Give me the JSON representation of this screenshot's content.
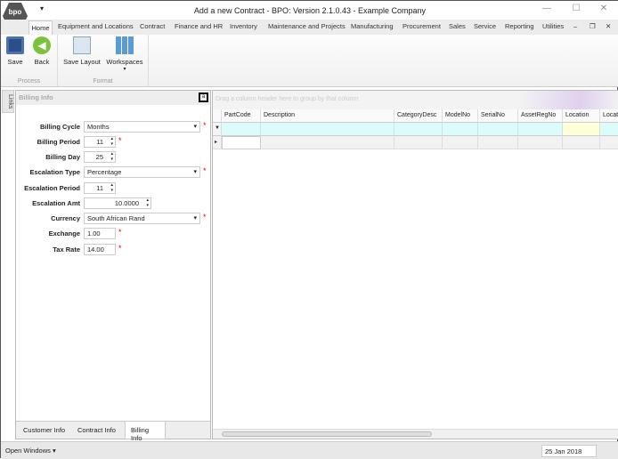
{
  "window": {
    "title": "Add a new Contract - BPO: Version 2.1.0.43 - Example Company",
    "logo": "bpo",
    "qat": "▾",
    "minimize": "—",
    "maximize": "☐",
    "close": "✕",
    "mdi_min": "–",
    "mdi_restore": "❐",
    "mdi_close": "✕"
  },
  "tabs": [
    "Home",
    "Equipment and Locations",
    "Contract",
    "Finance and HR",
    "Inventory",
    "Maintenance and Projects",
    "Manufacturing",
    "Procurement",
    "Sales",
    "Service",
    "Reporting",
    "Utilities"
  ],
  "ribbon": {
    "save": "Save",
    "back": "Back",
    "save_layout": "Save Layout",
    "workspaces": "Workspaces",
    "group_process": "Process",
    "group_format": "Format"
  },
  "links_tab": "Links",
  "panel": {
    "title": "Billing Info",
    "pin": "a",
    "fields": [
      {
        "label": "Billing Cycle",
        "value": "Months",
        "type": "dropdown",
        "required": true
      },
      {
        "label": "Billing Period",
        "value": "11",
        "type": "spin",
        "required": true
      },
      {
        "label": "Billing Day",
        "value": "25",
        "type": "spin",
        "required": false
      },
      {
        "label": "Escalation Type",
        "value": "Percentage",
        "type": "dropdown",
        "required": true
      },
      {
        "label": "Escalation Period",
        "value": "11",
        "type": "spin",
        "required": false
      },
      {
        "label": "Escalation Amt",
        "value": "10.0000",
        "type": "spinwide",
        "required": false
      },
      {
        "label": "Currency",
        "value": "South African Rand",
        "type": "dropdown",
        "required": true
      },
      {
        "label": "Exchange",
        "value": "1.00",
        "type": "text",
        "required": true
      },
      {
        "label": "Tax Rate",
        "value": "14.00",
        "type": "text",
        "required": true
      }
    ],
    "bottom_tabs": [
      "Customer Info",
      "Contract Info",
      "Billing Info"
    ],
    "required_mark": "*"
  },
  "grid": {
    "group_hint": "Drag a column header here to group by that column",
    "columns": [
      "PartCode",
      "Description",
      "CategoryDesc",
      "ModelNo",
      "SerialNo",
      "AssetRegNo",
      "Location",
      "Locat"
    ]
  },
  "status": {
    "open_windows": "Open Windows ▾",
    "date": "25 Jan 2018"
  }
}
